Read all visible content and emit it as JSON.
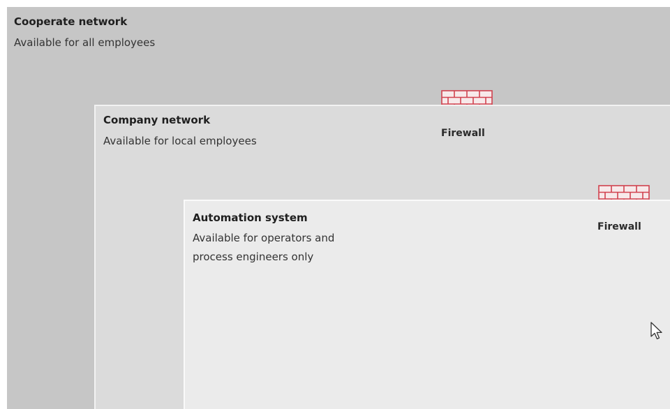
{
  "zones": {
    "outer": {
      "title": "Cooperate network",
      "description": "Available for all employees"
    },
    "mid": {
      "title": "Company network",
      "description": "Available for local employees"
    },
    "inner": {
      "title": "Automation system",
      "description_lines": [
        "Available for operators and",
        "process engineers only"
      ]
    }
  },
  "firewalls": [
    {
      "label": "Firewall",
      "icon": "brick-wall-icon"
    },
    {
      "label": "Firewall",
      "icon": "brick-wall-icon"
    }
  ],
  "colors": {
    "outer_zone": "#c6c6c6",
    "mid_zone": "#dbdbdb",
    "inner_zone": "#ebebeb",
    "firewall": "#d1424f"
  },
  "cursor_icon": "pointer-arrow-icon"
}
